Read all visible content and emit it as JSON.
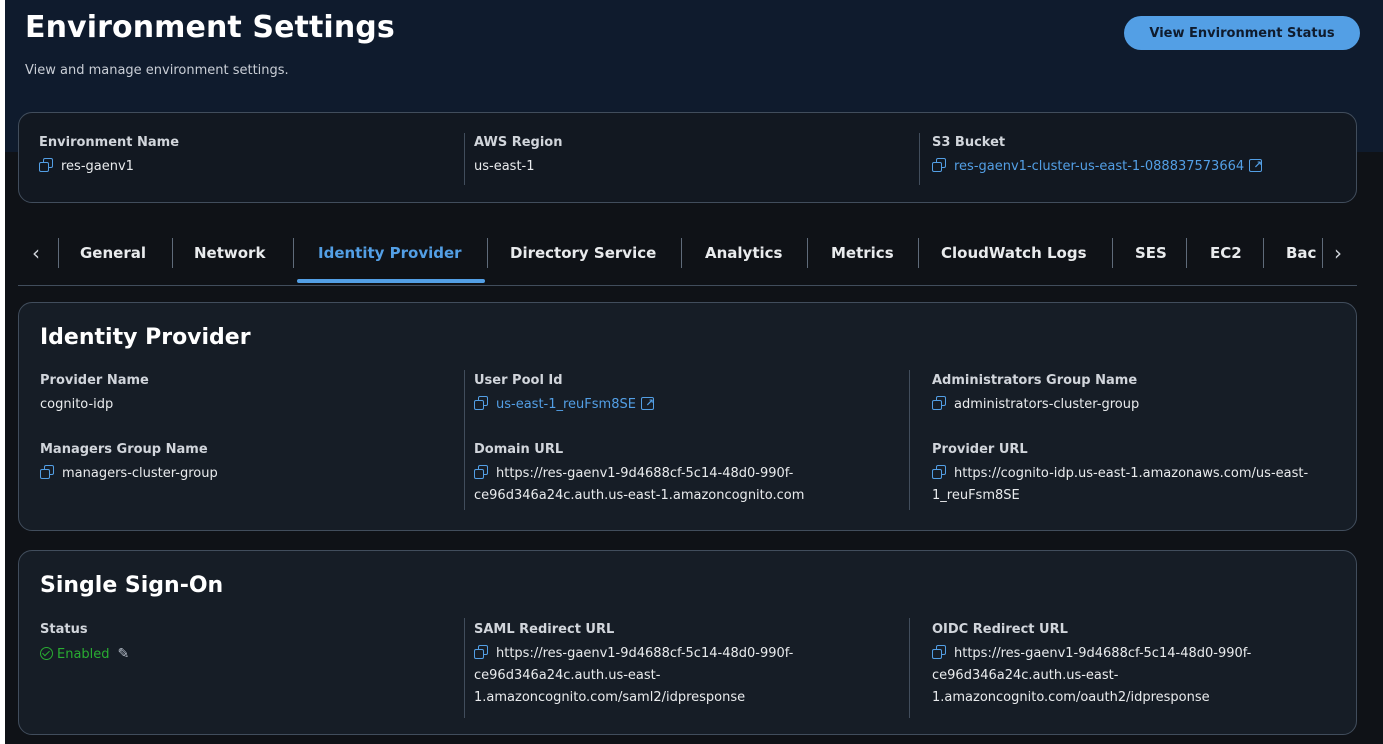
{
  "header": {
    "title": "Environment Settings",
    "subtitle": "View and manage environment settings.",
    "status_button": "View Environment Status"
  },
  "summary": {
    "environment_name_label": "Environment Name",
    "environment_name": "res-gaenv1",
    "region_label": "AWS Region",
    "region": "us-east-1",
    "bucket_label": "S3 Bucket",
    "bucket": "res-gaenv1-cluster-us-east-1-088837573664"
  },
  "tabs": [
    {
      "label": "General"
    },
    {
      "label": "Network"
    },
    {
      "label": "Identity Provider"
    },
    {
      "label": "Directory Service"
    },
    {
      "label": "Analytics"
    },
    {
      "label": "Metrics"
    },
    {
      "label": "CloudWatch Logs"
    },
    {
      "label": "SES"
    },
    {
      "label": "EC2"
    },
    {
      "label": "Bac"
    }
  ],
  "active_tab": "Identity Provider",
  "identity_provider": {
    "title": "Identity Provider",
    "provider_name_label": "Provider Name",
    "provider_name": "cognito-idp",
    "user_pool_label": "User Pool Id",
    "user_pool": "us-east-1_reuFsm8SE",
    "admin_group_label": "Administrators Group Name",
    "admin_group": "administrators-cluster-group",
    "managers_group_label": "Managers Group Name",
    "managers_group": "managers-cluster-group",
    "domain_url_label": "Domain URL",
    "domain_url_line1": "https://res-gaenv1-9d4688cf-5c14-48d0-990f-",
    "domain_url_line2": "ce96d346a24c.auth.us-east-1.amazoncognito.com",
    "provider_url_label": "Provider URL",
    "provider_url_line1": "https://cognito-idp.us-east-1.amazonaws.com/us-east-",
    "provider_url_line2": "1_reuFsm8SE"
  },
  "sso": {
    "title": "Single Sign-On",
    "status_label": "Status",
    "status": "Enabled",
    "saml_label": "SAML Redirect URL",
    "saml_line1": "https://res-gaenv1-9d4688cf-5c14-48d0-990f-",
    "saml_line2": "ce96d346a24c.auth.us-east-",
    "saml_line3": "1.amazoncognito.com/saml2/idpresponse",
    "oidc_label": "OIDC Redirect URL",
    "oidc_line1": "https://res-gaenv1-9d4688cf-5c14-48d0-990f-",
    "oidc_line2": "ce96d346a24c.auth.us-east-",
    "oidc_line3": "1.amazoncognito.com/oauth2/idpresponse"
  },
  "colors": {
    "accent": "#539fe5",
    "success": "#29ad32",
    "background": "#0f1217",
    "hero": "#0f1b2d"
  }
}
